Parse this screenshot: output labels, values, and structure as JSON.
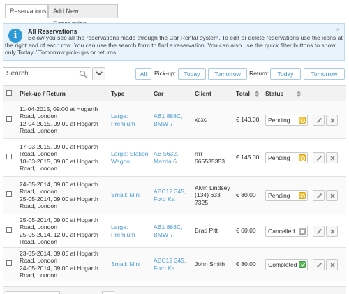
{
  "tabs": [
    {
      "label": "Reservations"
    },
    {
      "label": "Add New Reservation"
    }
  ],
  "info": {
    "title": "All Reservations",
    "text": "Below you see all the reservations made through the Car Rental system. To edit or delete reservations use the icons at the right end of each row. You can use the search form to find a reservation. You can also use the quick filter buttons to show only Today / Tomorrow pick-ups or returns.",
    "close": "×"
  },
  "toolbar": {
    "search_placeholder": "Search",
    "all_label": "All",
    "pickup_label": "Pick-up:",
    "pickup_today": "Today",
    "pickup_tomorrow": "Tomorrow",
    "return_label": "Return:",
    "return_today": "Today",
    "return_tomorrow": "Tomorrow"
  },
  "table": {
    "headers": {
      "pickup": "Pick-up / Return",
      "type": "Type",
      "car": "Car",
      "client": "Client",
      "total": "Total",
      "status": "Status"
    },
    "rows": [
      {
        "pickup1": "11-04-2015, 09:00 at Hogarth",
        "pickup2": "Road, London",
        "return1": "12-04-2015, 09:00 at Hogarth",
        "return2": "Road, London",
        "type1": "Large:",
        "type2": "Premium",
        "car1": "AB1 888C,",
        "car2": "BMW 7",
        "client1": "xcxc",
        "client2": "",
        "client3": "",
        "total": "€ 140.00",
        "status": "Pending",
        "status_kind": "pending"
      },
      {
        "pickup1": "17-03-2015, 09:00 at Hogarth",
        "pickup2": "Road, London",
        "return1": "18-03-2015, 09:00 at Hogarth",
        "return2": "Road, London",
        "type1": "Large: Station",
        "type2": "Wagon",
        "car1": "AB 5632,",
        "car2": "Mazda 6",
        "client1": "rrrr",
        "client2": "665535353",
        "client3": "",
        "total": "€ 145.00",
        "status": "Pending",
        "status_kind": "pending"
      },
      {
        "pickup1": "24-05-2014, 09:00 at Hogarth",
        "pickup2": "Road, London",
        "return1": "25-05-2014, 09:00 at Hogarth",
        "return2": "Road, London",
        "type1": "Small: Mini",
        "type2": "",
        "car1": "ABC12 345,",
        "car2": "Ford Ka",
        "client1": "Alvin Lindsey",
        "client2": "(134) 633",
        "client3": "7325",
        "total": "€ 80.00",
        "status": "Pending",
        "status_kind": "pending"
      },
      {
        "pickup1": "25-05-2014, 09:00 at Hogarth",
        "pickup2": "Road, London",
        "return1": "25-05-2014, 12:00 at Hogarth",
        "return2": "Road, London",
        "type1": "Large:",
        "type2": "Premium",
        "car1": "AB1 888C,",
        "car2": "BMW 7",
        "client1": "Brad Pitt",
        "client2": "",
        "client3": "",
        "total": "€ 60.00",
        "status": "Cancelled",
        "status_kind": "cancelled"
      },
      {
        "pickup1": "23-05-2014, 09:00 at Hogarth",
        "pickup2": "Road, London",
        "return1": "24-05-2014, 09:00 at Hogarth",
        "return2": "Road, London",
        "type1": "Small: Mini",
        "type2": "",
        "car1": "ABC12 345,",
        "car2": "Ford Ka",
        "client1": "John Smith",
        "client2": "",
        "client3": "",
        "total": "€ 80.00",
        "status": "Completed",
        "status_kind": "completed"
      }
    ]
  },
  "icons": {
    "search": "search-icon",
    "filter": "chevron-down-icon",
    "edit": "pencil-icon",
    "delete": "close-icon",
    "info": "info-icon"
  },
  "colors": {
    "accent": "#3b8fc9",
    "info_bg": "#e8f3fb",
    "pending": "#f4c542",
    "completed": "#5cb85c",
    "cancelled": "#b5b5b5"
  }
}
